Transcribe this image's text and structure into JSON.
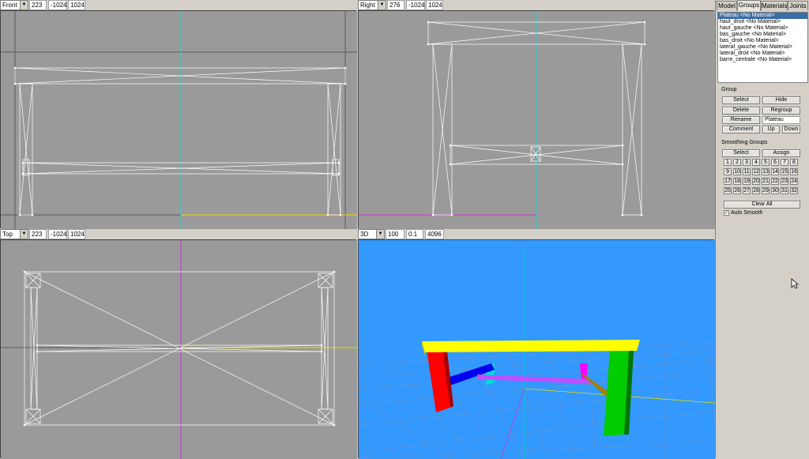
{
  "viewports": {
    "front": {
      "mode": "Front",
      "v1": "223",
      "v2": "-1024",
      "v3": "1024"
    },
    "right": {
      "mode": "Right",
      "v1": "276",
      "v2": "-1024",
      "v3": "1024"
    },
    "top": {
      "mode": "Top",
      "v1": "223",
      "v2": "-1024",
      "v3": "1024"
    },
    "persp": {
      "mode": "3D",
      "v1": "100",
      "v2": "0.1",
      "v3": "4096"
    }
  },
  "tabs": [
    "Model",
    "Groups",
    "Materials",
    "Joints"
  ],
  "active_tab": "Groups",
  "groups": [
    "Plateau <No Material>",
    "haut_droit <No Material>",
    "haut_gauche <No Material>",
    "bas_gauche <No Material>",
    "bas_droit <No Material>",
    "lateral_gauche <No Material>",
    "lateral_droit <No Material>",
    "barre_centrale <No Material>"
  ],
  "group_section": {
    "title": "Group",
    "select": "Select",
    "hide": "Hide",
    "delete": "Delete",
    "regroup": "Regroup",
    "rename": "Rename",
    "name_value": "Plateau",
    "comment": "Comment",
    "up": "Up",
    "down": "Down"
  },
  "smoothing": {
    "title": "Smoothing Groups",
    "select": "Select",
    "assign": "Assign",
    "numbers": [
      "1",
      "2",
      "3",
      "4",
      "5",
      "6",
      "7",
      "8",
      "9",
      "10",
      "11",
      "12",
      "13",
      "14",
      "15",
      "16",
      "17",
      "18",
      "19",
      "20",
      "21",
      "22",
      "23",
      "24",
      "25",
      "26",
      "27",
      "28",
      "29",
      "30",
      "31",
      "32"
    ],
    "clear_all": "Clear All",
    "auto_smooth": "Auto Smooth"
  },
  "colors": {
    "ortho_bg": "#9a9a9a",
    "persp_bg": "#3399ff",
    "wire": "#ffffff",
    "plateau": "#ffff00",
    "leg_red": "#ff0000",
    "leg_green": "#00cc00",
    "leg_cyan": "#00ffff",
    "leg_magenta": "#ff00ff",
    "bar_blue": "#0000ff",
    "bar_violet": "#b040ff",
    "bar_olive": "#a08000"
  }
}
